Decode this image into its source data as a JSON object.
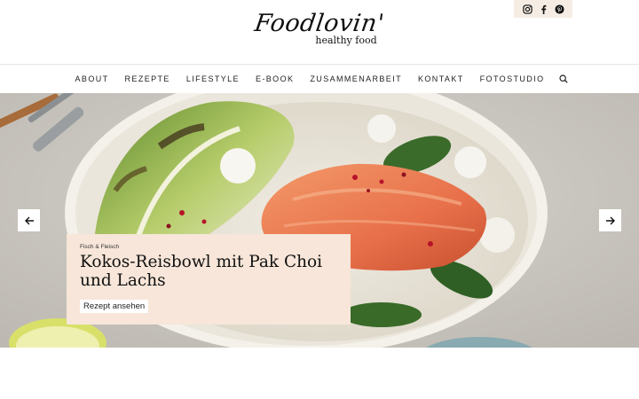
{
  "header": {
    "logo_script": "Foodlovin'",
    "logo_sub": "healthy food",
    "social": [
      "instagram-icon",
      "facebook-icon",
      "pinterest-icon"
    ]
  },
  "nav": {
    "items": [
      "ABOUT",
      "REZEPTE",
      "LIFESTYLE",
      "E-BOOK",
      "ZUSAMMENARBEIT",
      "KONTAKT",
      "FOTOSTUDIO"
    ],
    "search_icon": "search-icon"
  },
  "hero": {
    "category": "Fisch & Fleisch",
    "title": "Kokos-Reisbowl mit Pak Choi und Lachs",
    "link_label": "Rezept ansehen",
    "prev_icon": "arrow-left-icon",
    "next_icon": "arrow-right-icon"
  },
  "colors": {
    "card_bg": "#f7e6d9",
    "social_bg": "#f5ede4",
    "salmon": "#e8704a"
  }
}
